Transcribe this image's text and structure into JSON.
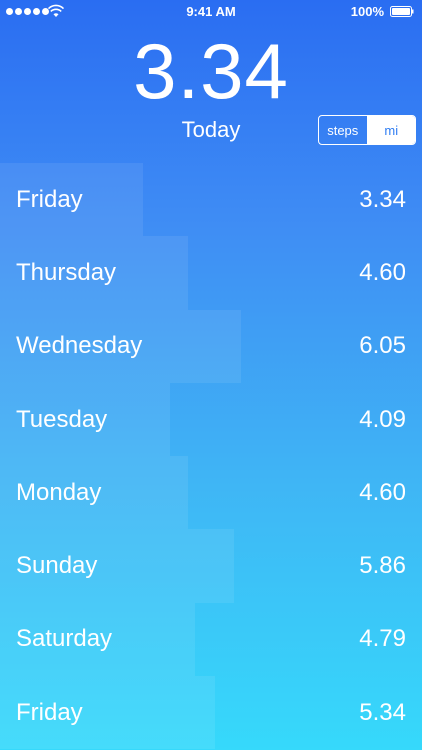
{
  "status_bar": {
    "time": "9:41 AM",
    "battery": "100%",
    "signal_dots": 5
  },
  "header": {
    "value": "3.34",
    "label": "Today",
    "unit_toggle": {
      "options": [
        "steps",
        "mi"
      ],
      "selected": "mi"
    }
  },
  "colors": {
    "top": "#2a6df2",
    "bottom": "#36d9fb",
    "selected_segment_text": "#2f7df2"
  },
  "days": [
    {
      "day": "Friday",
      "value": "3.34"
    },
    {
      "day": "Thursday",
      "value": "4.60"
    },
    {
      "day": "Wednesday",
      "value": "6.05"
    },
    {
      "day": "Tuesday",
      "value": "4.09"
    },
    {
      "day": "Monday",
      "value": "4.60"
    },
    {
      "day": "Sunday",
      "value": "5.86"
    },
    {
      "day": "Saturday",
      "value": "4.79"
    },
    {
      "day": "Friday",
      "value": "5.34"
    }
  ]
}
